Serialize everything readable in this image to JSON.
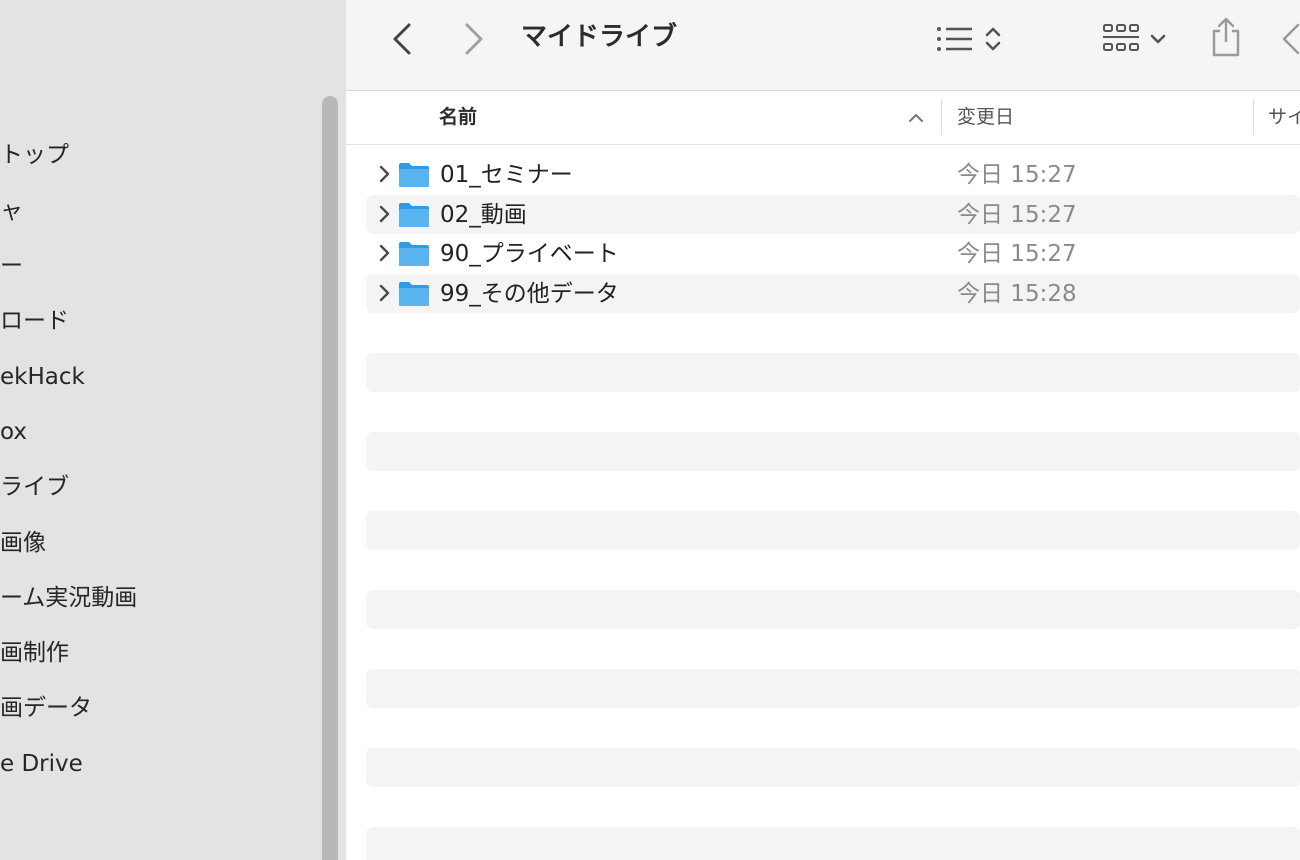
{
  "sidebar": {
    "items": [
      {
        "label": "トップ"
      },
      {
        "label": "ャ"
      },
      {
        "label": "ー"
      },
      {
        "label": "ロード"
      },
      {
        "label": "ekHack"
      },
      {
        "label": "ox"
      },
      {
        "label": "ライブ"
      },
      {
        "label": "画像"
      },
      {
        "label": "ーム実況動画"
      },
      {
        "label": "画制作"
      },
      {
        "label": "画データ"
      },
      {
        "label": "e Drive"
      }
    ]
  },
  "toolbar": {
    "title": "マイドライブ",
    "icons": {
      "back": "chevron-left-icon",
      "forward": "chevron-right-icon",
      "list_view": "list-icon",
      "grid_view": "grid-icon",
      "share": "share-icon"
    }
  },
  "columns": {
    "name": "名前",
    "modified": "変更日",
    "size": "サイ"
  },
  "files": [
    {
      "name": "01_セミナー",
      "modified": "今日 15:27"
    },
    {
      "name": "02_動画",
      "modified": "今日 15:27"
    },
    {
      "name": "90_プライベート",
      "modified": "今日 15:27"
    },
    {
      "name": "99_その他データ",
      "modified": "今日 15:28"
    }
  ],
  "colors": {
    "sidebar_bg": "#e3e3e3",
    "toolbar_bg": "#f5f5f5",
    "folder_blue": "#5ab4ef",
    "stripe": "#f4f4f4"
  }
}
